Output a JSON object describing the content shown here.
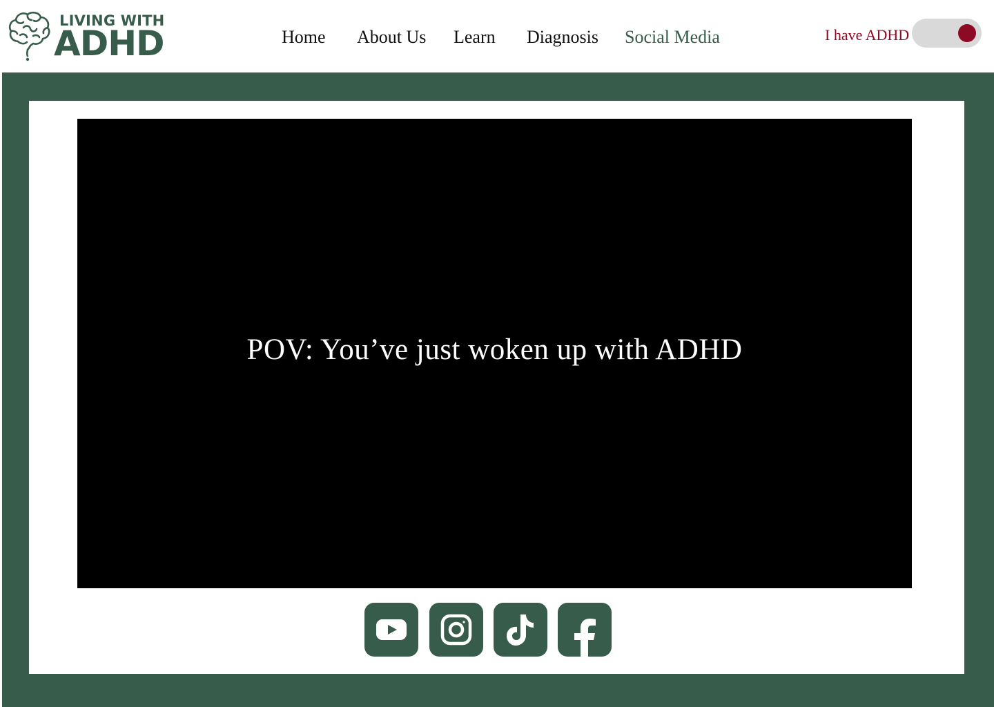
{
  "header": {
    "logo": {
      "top_text": "LIVING WITH",
      "main_text": "ADHD",
      "icon": "brain-icon"
    },
    "nav": [
      {
        "label": "Home",
        "active": false
      },
      {
        "label": "About Us",
        "active": false
      },
      {
        "label": "Learn",
        "active": false
      },
      {
        "label": "Diagnosis",
        "active": false
      },
      {
        "label": "Social Media",
        "active": true
      }
    ],
    "toggle": {
      "label": "I have ADHD",
      "on": true
    }
  },
  "main": {
    "video": {
      "caption": "POV: You’ve just woken up with ADHD"
    },
    "social_links": [
      {
        "name": "youtube",
        "icon": "youtube-icon"
      },
      {
        "name": "instagram",
        "icon": "instagram-icon"
      },
      {
        "name": "tiktok",
        "icon": "tiktok-icon"
      },
      {
        "name": "facebook",
        "icon": "facebook-icon"
      }
    ]
  },
  "colors": {
    "brand_green": "#385c4b",
    "accent_red": "#8c0a24",
    "toggle_track": "#d9d9d9",
    "video_bg": "#000000"
  }
}
